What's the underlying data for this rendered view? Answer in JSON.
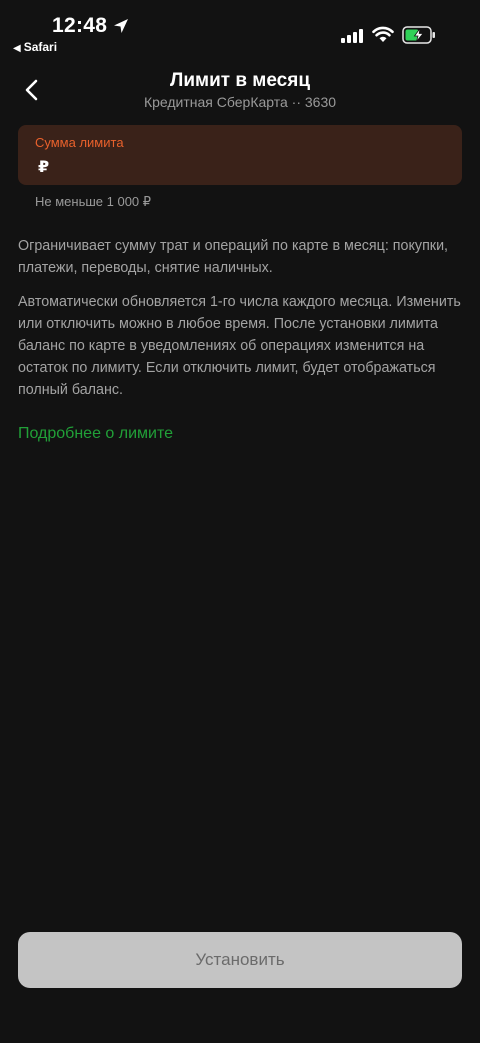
{
  "status_bar": {
    "time": "12:48",
    "back_app_label": "Safari",
    "icons": [
      "location-arrow-icon",
      "cellular-signal-icon",
      "wifi-icon",
      "battery-charging-icon"
    ],
    "battery_color": "#30d158"
  },
  "header": {
    "title": "Лимит в месяц",
    "subtitle": "Кредитная СберКарта ·· 3630"
  },
  "limit_field": {
    "label": "Сумма лимита",
    "currency": "₽",
    "hint": "Не меньше 1 000 ₽"
  },
  "description": {
    "paragraph_1": "Ограничивает сумму трат и операций по карте в месяц: покупки, платежи, переводы, снятие наличных.",
    "paragraph_2": "Автоматически обновляется 1-го числа каждого месяца. Изменить или отключить можно в любое время. После установки лимита баланс по карте в уведомлениях об операциях изменится на остаток по лимиту. Если отключить лимит, будет отображаться полный баланс."
  },
  "more_link": "Подробнее о лимите",
  "submit_button": "Установить",
  "colors": {
    "background": "#121212",
    "accent_green": "#21a038",
    "field_label_orange": "#e8612c",
    "field_background": "#3a2219"
  }
}
